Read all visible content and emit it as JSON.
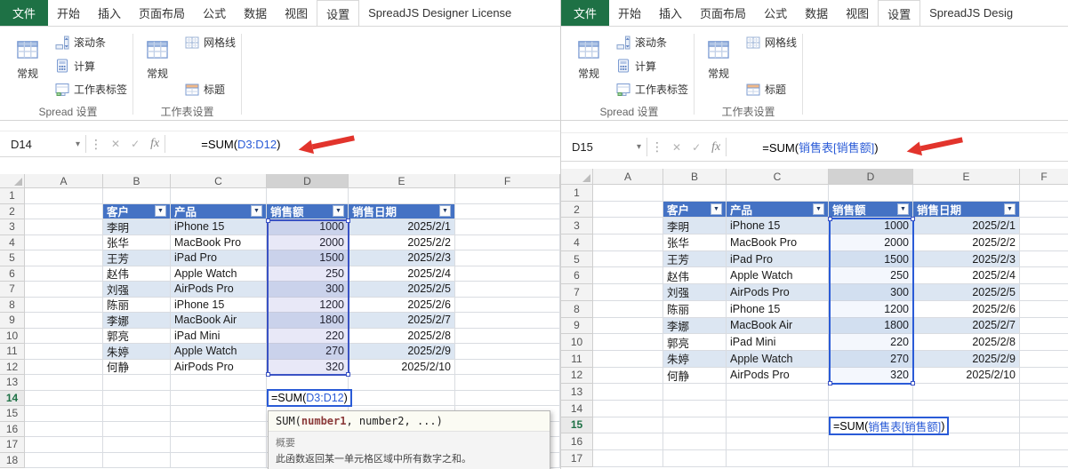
{
  "colors": {
    "file_tab": "#1e7145",
    "table_header": "#4472c4",
    "row_band": "#dce6f2",
    "selection_border": "#2a5bd7",
    "reference_text": "#2a5bd7",
    "annotation_arrow": "#e2342c"
  },
  "glyphs": {
    "dropdown": "▾",
    "kebab": "⋮",
    "cancel": "✕",
    "confirm": "✓",
    "fx": "fx",
    "filter": "▼"
  },
  "shared": {
    "col_letters": [
      "A",
      "B",
      "C",
      "D",
      "E",
      "F"
    ],
    "table": {
      "headers": [
        "客户",
        "产品",
        "销售额",
        "销售日期"
      ],
      "rows": [
        [
          "李明",
          "iPhone 15",
          "1000",
          "2025/2/1"
        ],
        [
          "张华",
          "MacBook Pro",
          "2000",
          "2025/2/2"
        ],
        [
          "王芳",
          "iPad Pro",
          "1500",
          "2025/2/3"
        ],
        [
          "赵伟",
          "Apple Watch",
          "250",
          "2025/2/4"
        ],
        [
          "刘强",
          "AirPods Pro",
          "300",
          "2025/2/5"
        ],
        [
          "陈丽",
          "iPhone 15",
          "1200",
          "2025/2/6"
        ],
        [
          "李娜",
          "MacBook Air",
          "1800",
          "2025/2/7"
        ],
        [
          "郭亮",
          "iPad Mini",
          "220",
          "2025/2/8"
        ],
        [
          "朱婷",
          "Apple Watch",
          "270",
          "2025/2/9"
        ],
        [
          "何静",
          "AirPods Pro",
          "320",
          "2025/2/10"
        ]
      ]
    }
  },
  "panels": [
    {
      "tabs": [
        "文件",
        "开始",
        "插入",
        "页面布局",
        "公式",
        "数据",
        "视图",
        "设置",
        "SpreadJS Designer License"
      ],
      "selected_tab": "设置",
      "ribbon_groups": [
        {
          "label": "Spread 设置",
          "big": {
            "label": "常规",
            "icon": "general-icon"
          },
          "small": [
            {
              "label": "滚动条",
              "icon": "scrollbar-icon"
            },
            {
              "label": "计算",
              "icon": "calculator-icon"
            },
            {
              "label": "工作表标签",
              "icon": "sheet-tab-icon"
            }
          ]
        },
        {
          "label": "工作表设置",
          "big": {
            "label": "常规",
            "icon": "general-icon"
          },
          "small": [
            {
              "label": "网格线",
              "icon": "gridlines-icon"
            },
            {
              "label": "标题",
              "icon": "title-icon"
            }
          ]
        }
      ],
      "name_box": "D14",
      "active_cell": "D14",
      "selected_range": "D3:D12",
      "formula": {
        "prefix": "=SUM(",
        "ref": "D3:D12",
        "suffix": ")"
      },
      "row_count": 18,
      "edit_row": 14,
      "tooltip": {
        "signature_prefix": "SUM(",
        "signature_highlight": "number1",
        "signature_suffix": ", number2, ...)",
        "summary_label": "概要",
        "summary_text": "此函数返回某一单元格区域中所有数字之和。"
      }
    },
    {
      "tabs": [
        "文件",
        "开始",
        "插入",
        "页面布局",
        "公式",
        "数据",
        "视图",
        "设置",
        "SpreadJS Desig"
      ],
      "selected_tab": "设置",
      "ribbon_groups": [
        {
          "label": "Spread 设置",
          "big": {
            "label": "常规",
            "icon": "general-icon"
          },
          "small": [
            {
              "label": "滚动条",
              "icon": "scrollbar-icon"
            },
            {
              "label": "计算",
              "icon": "calculator-icon"
            },
            {
              "label": "工作表标签",
              "icon": "sheet-tab-icon"
            }
          ]
        },
        {
          "label": "工作表设置",
          "big": {
            "label": "常规",
            "icon": "general-icon"
          },
          "small": [
            {
              "label": "网格线",
              "icon": "gridlines-icon"
            },
            {
              "label": "标题",
              "icon": "title-icon"
            }
          ]
        }
      ],
      "name_box": "D15",
      "active_cell": "D15",
      "selected_range": "D3:D12",
      "formula": {
        "prefix": "=SUM(",
        "ref": "销售表[销售额]",
        "suffix": ")"
      },
      "row_count": 17,
      "edit_row": 15
    }
  ]
}
